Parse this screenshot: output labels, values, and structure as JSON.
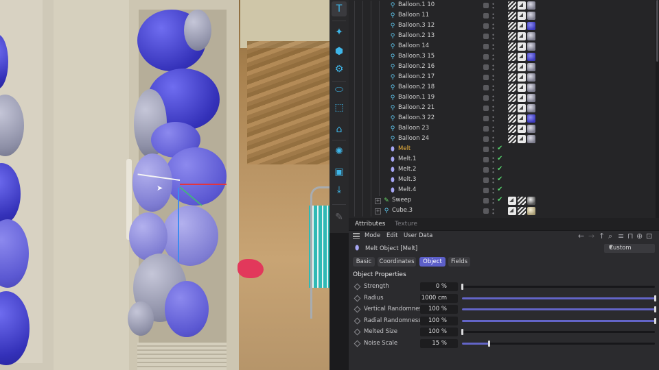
{
  "toolbar": {
    "tools": [
      {
        "icon": "text-icon",
        "glyph": "T"
      },
      {
        "icon": "emitter-icon",
        "glyph": "✦"
      },
      {
        "icon": "mograph-cloner-icon",
        "glyph": "⬢"
      },
      {
        "icon": "effector-gear-icon",
        "glyph": "⚙"
      },
      {
        "icon": "deformer-icon",
        "glyph": "⬭"
      },
      {
        "icon": "axis-cube-icon",
        "glyph": "⬚"
      },
      {
        "icon": "spline-icon",
        "glyph": "⌂"
      },
      {
        "icon": "environment-icon",
        "glyph": "✺"
      },
      {
        "icon": "camera-icon",
        "glyph": "▣"
      },
      {
        "icon": "render-tag-icon",
        "glyph": "⤓"
      },
      {
        "icon": "disabled-pen-icon",
        "glyph": "✎"
      }
    ]
  },
  "object_manager": {
    "rows": [
      {
        "name": "Balloon.1 10",
        "kind": "balloon",
        "mat": "mat-grey",
        "indent": 2
      },
      {
        "name": "Balloon 11",
        "kind": "balloon",
        "mat": "mat-grey",
        "indent": 2
      },
      {
        "name": "Balloon.3 12",
        "kind": "balloon",
        "mat": "mat-blue",
        "indent": 2
      },
      {
        "name": "Balloon.2 13",
        "kind": "balloon",
        "mat": "mat-grey",
        "indent": 2
      },
      {
        "name": "Balloon 14",
        "kind": "balloon",
        "mat": "mat-grey",
        "indent": 2
      },
      {
        "name": "Balloon.3 15",
        "kind": "balloon",
        "mat": "mat-blue",
        "indent": 2
      },
      {
        "name": "Balloon.2 16",
        "kind": "balloon",
        "mat": "mat-grey",
        "indent": 2
      },
      {
        "name": "Balloon.2 17",
        "kind": "balloon",
        "mat": "mat-grey",
        "indent": 2
      },
      {
        "name": "Balloon.2 18",
        "kind": "balloon",
        "mat": "mat-grey",
        "indent": 2
      },
      {
        "name": "Balloon.1 19",
        "kind": "balloon",
        "mat": "mat-grey",
        "indent": 2
      },
      {
        "name": "Balloon.2 21",
        "kind": "balloon",
        "mat": "mat-grey",
        "indent": 2
      },
      {
        "name": "Balloon.3 22",
        "kind": "balloon",
        "mat": "mat-blue",
        "indent": 2
      },
      {
        "name": "Balloon 23",
        "kind": "balloon",
        "mat": "mat-grey",
        "indent": 2
      },
      {
        "name": "Balloon 24",
        "kind": "balloon",
        "mat": "mat-grey",
        "indent": 2
      },
      {
        "name": "Melt",
        "kind": "melt",
        "indent": 1,
        "selected": true
      },
      {
        "name": "Melt.1",
        "kind": "melt",
        "indent": 1
      },
      {
        "name": "Melt.2",
        "kind": "melt",
        "indent": 1
      },
      {
        "name": "Melt.3",
        "kind": "melt",
        "indent": 1
      },
      {
        "name": "Melt.4",
        "kind": "melt",
        "indent": 1
      },
      {
        "name": "Sweep",
        "kind": "sweep",
        "indent": 0,
        "expander": "+",
        "mat": "mat-dark"
      },
      {
        "name": "Cube.3",
        "kind": "cube",
        "indent": 0,
        "expander": "+",
        "mat": "mat-cream"
      }
    ]
  },
  "attributes": {
    "tabs": [
      "Attributes",
      "Texture"
    ],
    "active_tab": "Attributes",
    "menu": [
      "Mode",
      "Edit",
      "User Data"
    ],
    "object_title": "Melt Object [Melt]",
    "mode_value": "Custom",
    "subtabs": [
      "Basic",
      "Coordinates",
      "Object",
      "Fields"
    ],
    "active_subtab": "Object",
    "section_title": "Object Properties",
    "properties": [
      {
        "label": "Strength",
        "value": "0 %",
        "fraction": 0.0
      },
      {
        "label": "Radius",
        "value": "1000 cm",
        "fraction": 1.0
      },
      {
        "label": "Vertical Randomness",
        "value": "100 %",
        "fraction": 1.0
      },
      {
        "label": "Radial Randomness",
        "value": "100 %",
        "fraction": 1.0
      },
      {
        "label": "Melted Size",
        "value": "100 %",
        "fraction": 0.0
      },
      {
        "label": "Noise Scale",
        "value": "15 %",
        "fraction": 0.14
      }
    ]
  },
  "colors": {
    "accent": "#5c5fc9",
    "selected_text": "#f2b63d",
    "check": "#54d06b",
    "tool_icon": "#3fb6e8"
  }
}
